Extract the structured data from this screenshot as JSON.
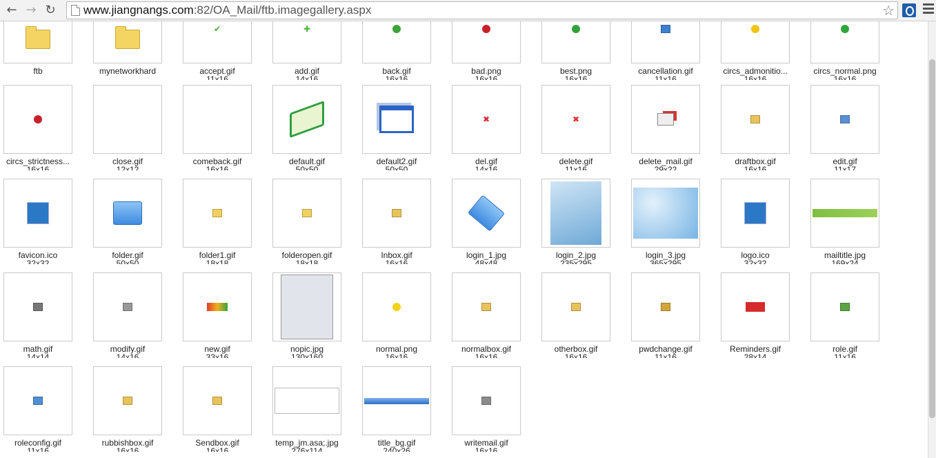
{
  "browser": {
    "url_host": "www.jiangnangs.com",
    "url_rest": ":82/OA_Mail/ftb.imagegallery.aspx",
    "back_icon": "back-arrow-icon",
    "forward_icon": "forward-arrow-icon",
    "reload_icon": "reload-icon",
    "star_icon": "bookmark-star-icon",
    "menu_icon": "menu-icon"
  },
  "gallery": {
    "rows": [
      [
        {
          "name": "ftb",
          "size": "",
          "icon": "folder-icon",
          "color": "#f4d463"
        },
        {
          "name": "mynetworkhard",
          "size": "",
          "icon": "folder-icon",
          "color": "#f4d463"
        },
        {
          "name": "accept.gif",
          "size": "11x16",
          "icon": "checkmark-icon",
          "color": "#46a83a"
        },
        {
          "name": "add.gif",
          "size": "14x16",
          "icon": "plus-icon",
          "color": "#52b341"
        },
        {
          "name": "back.gif",
          "size": "16x16",
          "icon": "back-circle-icon",
          "color": "#3ea33a"
        },
        {
          "name": "bad.png",
          "size": "16x16",
          "icon": "sad-face-icon",
          "color": "#c8202a"
        },
        {
          "name": "best.png",
          "size": "16x16",
          "icon": "happy-face-icon",
          "color": "#33a23b"
        },
        {
          "name": "cancellation.gif",
          "size": "11x16",
          "icon": "cancellation-icon",
          "color": "#3d7fd0"
        },
        {
          "name": "circs_admonitio...",
          "size": "16x16",
          "icon": "warning-circle-icon",
          "color": "#f1c40f"
        },
        {
          "name": "circs_normal.png",
          "size": "16x16",
          "icon": "check-circle-icon",
          "color": "#2fa53c"
        }
      ],
      [
        {
          "name": "circs_strictness...",
          "size": "16x16",
          "icon": "alert-circle-icon",
          "color": "#c8202a"
        },
        {
          "name": "close.gif",
          "size": "12x12",
          "icon": "",
          "color": ""
        },
        {
          "name": "comeback.gif",
          "size": "16x16",
          "icon": "",
          "color": ""
        },
        {
          "name": "default.gif",
          "size": "50x50",
          "icon": "open-book-icon",
          "color": "#2f9d3f"
        },
        {
          "name": "default2.gif",
          "size": "50x50",
          "icon": "window-icon",
          "color": "#2a63c4"
        },
        {
          "name": "del.gif",
          "size": "14x16",
          "icon": "delete-x-icon",
          "color": "#d62d3a"
        },
        {
          "name": "delete.gif",
          "size": "11x16",
          "icon": "delete-x-icon",
          "color": "#e0332e"
        },
        {
          "name": "delete_mail.gif",
          "size": "29x22",
          "icon": "delete-mail-icon",
          "color": "#d63232"
        },
        {
          "name": "draftbox.gif",
          "size": "16x16",
          "icon": "draftbox-icon",
          "color": "#e8c35a"
        },
        {
          "name": "edit.gif",
          "size": "11x17",
          "icon": "edit-icon",
          "color": "#5b8fd4"
        }
      ],
      [
        {
          "name": "favicon.ico",
          "size": "32x32",
          "icon": "logo-tile-icon",
          "color": "#2b78c7"
        },
        {
          "name": "folder.gif",
          "size": "50x50",
          "icon": "blue-folder-icon",
          "color": "#3f8be0"
        },
        {
          "name": "folder1.gif",
          "size": "18x18",
          "icon": "small-folder-icon",
          "color": "#f2d060"
        },
        {
          "name": "folderopen.gif",
          "size": "18x18",
          "icon": "open-folder-icon",
          "color": "#f2d060"
        },
        {
          "name": "Inbox.gif",
          "size": "16x16",
          "icon": "inbox-icon",
          "color": "#e6c457"
        },
        {
          "name": "login_1.jpg",
          "size": "48x48",
          "icon": "blue-folder-tilted-icon",
          "color": "#3f8be0"
        },
        {
          "name": "login_2.jpg",
          "size": "235x295",
          "icon": "keyboard-photo-icon",
          "color": "#6fa9d6"
        },
        {
          "name": "login_3.jpg",
          "size": "365x295",
          "icon": "blue-wallpaper-icon",
          "color": "#78b4e4"
        },
        {
          "name": "logo.ico",
          "size": "32x32",
          "icon": "logo-tile-icon",
          "color": "#2b78c7"
        },
        {
          "name": "mailtitle.jpg",
          "size": "169x24",
          "icon": "green-bar-icon",
          "color": "#9ed15a"
        }
      ],
      [
        {
          "name": "math.gif",
          "size": "14x14",
          "icon": "paperclip-icon",
          "color": "#777777"
        },
        {
          "name": "modify.gif",
          "size": "14x16",
          "icon": "gear-icon",
          "color": "#999999"
        },
        {
          "name": "new.gif",
          "size": "33x16",
          "icon": "new-badge-icon",
          "color": "#e23a2c"
        },
        {
          "name": "nopic.jpg",
          "size": "130x160",
          "icon": "person-placeholder-icon",
          "color": "#9aa4c4"
        },
        {
          "name": "normal.png",
          "size": "16x16",
          "icon": "smile-face-icon",
          "color": "#f3d21a"
        },
        {
          "name": "normalbox.gif",
          "size": "16x16",
          "icon": "box-folder-icon",
          "color": "#e8c35a"
        },
        {
          "name": "otherbox.gif",
          "size": "16x16",
          "icon": "other-box-icon",
          "color": "#e8c35a"
        },
        {
          "name": "pwdchange.gif",
          "size": "11x16",
          "icon": "key-icon",
          "color": "#d2a63a"
        },
        {
          "name": "Reminders.gif",
          "size": "28x14",
          "icon": "reminder-badge-icon",
          "color": "#d62b2b"
        },
        {
          "name": "role.gif",
          "size": "11x16",
          "icon": "user-icon",
          "color": "#5aa542"
        }
      ],
      [
        {
          "name": "roleconfig.gif",
          "size": "11x16",
          "icon": "user-group-icon",
          "color": "#4f8fd3"
        },
        {
          "name": "rubbishbox.gif",
          "size": "16x16",
          "icon": "rubbish-box-icon",
          "color": "#e8c35a"
        },
        {
          "name": "Sendbox.gif",
          "size": "16x16",
          "icon": "sendbox-icon",
          "color": "#e8c35a"
        },
        {
          "name": "temp_jm.asa;.jpg",
          "size": "276x114",
          "icon": "broken-image-icon",
          "color": "#cccccc"
        },
        {
          "name": "title_bg.gif",
          "size": "240x26",
          "icon": "blue-bar-icon",
          "color": "#2f6fc4"
        },
        {
          "name": "writemail.gif",
          "size": "16x16",
          "icon": "write-mail-icon",
          "color": "#8c8c8c"
        }
      ]
    ]
  }
}
